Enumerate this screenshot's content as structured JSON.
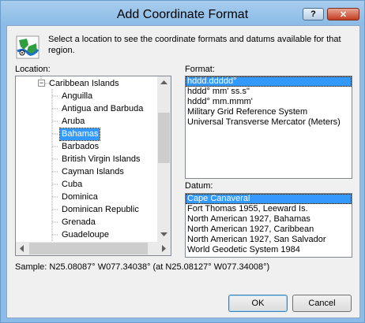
{
  "window": {
    "title": "Add Coordinate Format",
    "help_label": "?",
    "close_label": "✕"
  },
  "intro": {
    "text": "Select a location to see the coordinate formats and datums available for that region."
  },
  "location": {
    "label": "Location:",
    "parent": "Caribbean Islands",
    "expander": "−",
    "items": [
      "Anguilla",
      "Antigua and Barbuda",
      "Aruba",
      "Bahamas",
      "Barbados",
      "British Virgin Islands",
      "Cayman Islands",
      "Cuba",
      "Dominica",
      "Dominican Republic",
      "Grenada",
      "Guadeloupe"
    ],
    "selected": "Bahamas"
  },
  "format": {
    "label": "Format:",
    "items": [
      "hddd.ddddd°",
      "hddd° mm' ss.s\"",
      "hddd° mm.mmm'",
      "Military Grid Reference System",
      "Universal Transverse Mercator (Meters)"
    ],
    "selected": "hddd.ddddd°"
  },
  "datum": {
    "label": "Datum:",
    "items": [
      "Cape Canaveral",
      "Fort Thomas 1955, Leeward Is.",
      "North American 1927, Bahamas",
      "North American 1927, Caribbean",
      "North American 1927, San Salvador",
      "World Geodetic System 1984"
    ],
    "selected": "Cape Canaveral"
  },
  "sample": {
    "text": "Sample: N25.08087°  W077.34038° (at N25.08127°  W077.34008°)"
  },
  "buttons": {
    "ok": "OK",
    "cancel": "Cancel"
  },
  "icons": {
    "app": "globe-map-icon"
  },
  "colors": {
    "selection": "#3399ff",
    "title_bar": "#8bbbe6",
    "close_button": "#c43c20"
  }
}
